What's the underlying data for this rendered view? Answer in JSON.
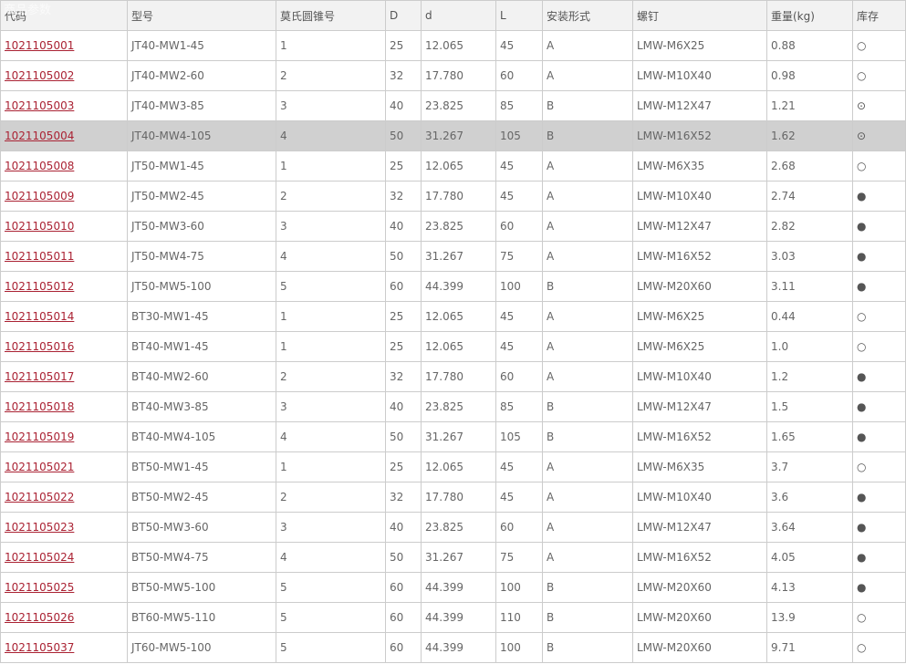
{
  "page_title": "商品参数",
  "columns": [
    "代码",
    "型号",
    "莫氏圆锥号",
    "D",
    "d",
    "L",
    "安装形式",
    "螺钉",
    "重量(kg)",
    "库存"
  ],
  "highlight_row_index": 3,
  "rows": [
    {
      "code": "1021105001",
      "model": "JT40-MW1-45",
      "morse": "1",
      "D": "25",
      "d": "12.065",
      "L": "45",
      "mount": "A",
      "screw": "LMW-M6X25",
      "weight": "0.88",
      "stock": "○"
    },
    {
      "code": "1021105002",
      "model": "JT40-MW2-60",
      "morse": "2",
      "D": "32",
      "d": "17.780",
      "L": "60",
      "mount": "A",
      "screw": "LMW-M10X40",
      "weight": "0.98",
      "stock": "○"
    },
    {
      "code": "1021105003",
      "model": "JT40-MW3-85",
      "morse": "3",
      "D": "40",
      "d": "23.825",
      "L": "85",
      "mount": "B",
      "screw": "LMW-M12X47",
      "weight": "1.21",
      "stock": "⊙"
    },
    {
      "code": "1021105004",
      "model": "JT40-MW4-105",
      "morse": "4",
      "D": "50",
      "d": "31.267",
      "L": "105",
      "mount": "B",
      "screw": "LMW-M16X52",
      "weight": "1.62",
      "stock": "⊙"
    },
    {
      "code": "1021105008",
      "model": "JT50-MW1-45",
      "morse": "1",
      "D": "25",
      "d": "12.065",
      "L": "45",
      "mount": "A",
      "screw": "LMW-M6X35",
      "weight": "2.68",
      "stock": "○"
    },
    {
      "code": "1021105009",
      "model": "JT50-MW2-45",
      "morse": "2",
      "D": "32",
      "d": "17.780",
      "L": "45",
      "mount": "A",
      "screw": "LMW-M10X40",
      "weight": "2.74",
      "stock": "●"
    },
    {
      "code": "1021105010",
      "model": "JT50-MW3-60",
      "morse": "3",
      "D": "40",
      "d": "23.825",
      "L": "60",
      "mount": "A",
      "screw": "LMW-M12X47",
      "weight": "2.82",
      "stock": "●"
    },
    {
      "code": "1021105011",
      "model": "JT50-MW4-75",
      "morse": "4",
      "D": "50",
      "d": "31.267",
      "L": "75",
      "mount": "A",
      "screw": "LMW-M16X52",
      "weight": "3.03",
      "stock": "●"
    },
    {
      "code": "1021105012",
      "model": "JT50-MW5-100",
      "morse": "5",
      "D": "60",
      "d": "44.399",
      "L": "100",
      "mount": "B",
      "screw": "LMW-M20X60",
      "weight": "3.11",
      "stock": "●"
    },
    {
      "code": "1021105014",
      "model": "BT30-MW1-45",
      "morse": "1",
      "D": "25",
      "d": "12.065",
      "L": "45",
      "mount": "A",
      "screw": "LMW-M6X25",
      "weight": "0.44",
      "stock": "○"
    },
    {
      "code": "1021105016",
      "model": "BT40-MW1-45",
      "morse": "1",
      "D": "25",
      "d": "12.065",
      "L": "45",
      "mount": "A",
      "screw": "LMW-M6X25",
      "weight": "1.0",
      "stock": "○"
    },
    {
      "code": "1021105017",
      "model": "BT40-MW2-60",
      "morse": "2",
      "D": "32",
      "d": "17.780",
      "L": "60",
      "mount": "A",
      "screw": "LMW-M10X40",
      "weight": "1.2",
      "stock": "●"
    },
    {
      "code": "1021105018",
      "model": "BT40-MW3-85",
      "morse": "3",
      "D": "40",
      "d": "23.825",
      "L": "85",
      "mount": "B",
      "screw": "LMW-M12X47",
      "weight": "1.5",
      "stock": "●"
    },
    {
      "code": "1021105019",
      "model": "BT40-MW4-105",
      "morse": "4",
      "D": "50",
      "d": "31.267",
      "L": "105",
      "mount": "B",
      "screw": "LMW-M16X52",
      "weight": "1.65",
      "stock": "●"
    },
    {
      "code": "1021105021",
      "model": "BT50-MW1-45",
      "morse": "1",
      "D": "25",
      "d": "12.065",
      "L": "45",
      "mount": "A",
      "screw": "LMW-M6X35",
      "weight": "3.7",
      "stock": "○"
    },
    {
      "code": "1021105022",
      "model": "BT50-MW2-45",
      "morse": "2",
      "D": "32",
      "d": "17.780",
      "L": "45",
      "mount": "A",
      "screw": "LMW-M10X40",
      "weight": "3.6",
      "stock": "●"
    },
    {
      "code": "1021105023",
      "model": "BT50-MW3-60",
      "morse": "3",
      "D": "40",
      "d": "23.825",
      "L": "60",
      "mount": "A",
      "screw": "LMW-M12X47",
      "weight": "3.64",
      "stock": "●"
    },
    {
      "code": "1021105024",
      "model": "BT50-MW4-75",
      "morse": "4",
      "D": "50",
      "d": "31.267",
      "L": "75",
      "mount": "A",
      "screw": "LMW-M16X52",
      "weight": "4.05",
      "stock": "●"
    },
    {
      "code": "1021105025",
      "model": "BT50-MW5-100",
      "morse": "5",
      "D": "60",
      "d": "44.399",
      "L": "100",
      "mount": "B",
      "screw": "LMW-M20X60",
      "weight": "4.13",
      "stock": "●"
    },
    {
      "code": "1021105026",
      "model": "BT60-MW5-110",
      "morse": "5",
      "D": "60",
      "d": "44.399",
      "L": "110",
      "mount": "B",
      "screw": "LMW-M20X60",
      "weight": "13.9",
      "stock": "○"
    },
    {
      "code": "1021105037",
      "model": "JT60-MW5-100",
      "morse": "5",
      "D": "60",
      "d": "44.399",
      "L": "100",
      "mount": "B",
      "screw": "LMW-M20X60",
      "weight": "9.71",
      "stock": "○"
    }
  ],
  "colors": {
    "link": "#aa2233",
    "header_bg": "#f2f2f2",
    "highlight_bg": "#d0d0d0",
    "border": "#cccccc"
  }
}
